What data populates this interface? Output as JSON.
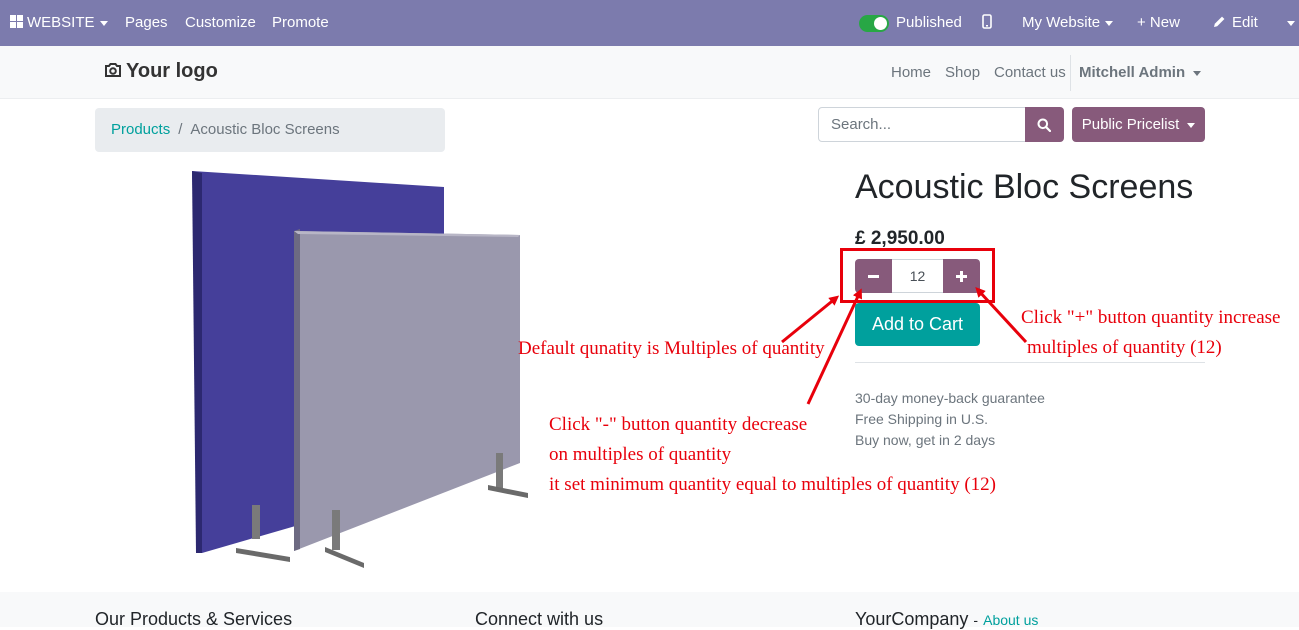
{
  "admin_bar": {
    "website_label": "WEBSITE",
    "pages_label": "Pages",
    "customize_label": "Customize",
    "promote_label": "Promote",
    "published_label": "Published",
    "my_website_label": "My Website",
    "new_label": "+ New",
    "edit_label": "Edit"
  },
  "header": {
    "logo_text": "Your logo",
    "nav": [
      "Home",
      "Shop",
      "Contact us"
    ],
    "user_label": "Mitchell Admin"
  },
  "breadcrumb": {
    "link": "Products",
    "separator": "/",
    "current": "Acoustic Bloc Screens"
  },
  "search": {
    "placeholder": "Search...",
    "pricelist_label": "Public Pricelist"
  },
  "product": {
    "title": "Acoustic Bloc Screens",
    "price": "£ 2,950.00",
    "quantity": "12",
    "add_to_cart_label": "Add to Cart",
    "perks": [
      "30-day money-back guarantee",
      "Free Shipping in U.S.",
      "Buy now, get in 2 days"
    ]
  },
  "annotations": {
    "default_qty": "Default qunatity is Multiples of quantity",
    "plus_line1": "Click \"+\" button quantity increase",
    "plus_line2": "multiples of quantity (12)",
    "minus_line1": "Click \"-\" button quantity decrease",
    "minus_line2": "on multiples of quantity",
    "minus_line3": "it set minimum quantity equal to multiples of quantity (12)"
  },
  "footer": {
    "col1_title": "Our Products & Services",
    "col2_title": "Connect with us",
    "col3_title": "YourCompany",
    "col3_dash": "-",
    "col3_link": "About us"
  },
  "colors": {
    "admin_bar": "#7c7bad",
    "brand_purple": "#875a7b",
    "teal": "#00a09d",
    "annotation_red": "#e8000b"
  }
}
